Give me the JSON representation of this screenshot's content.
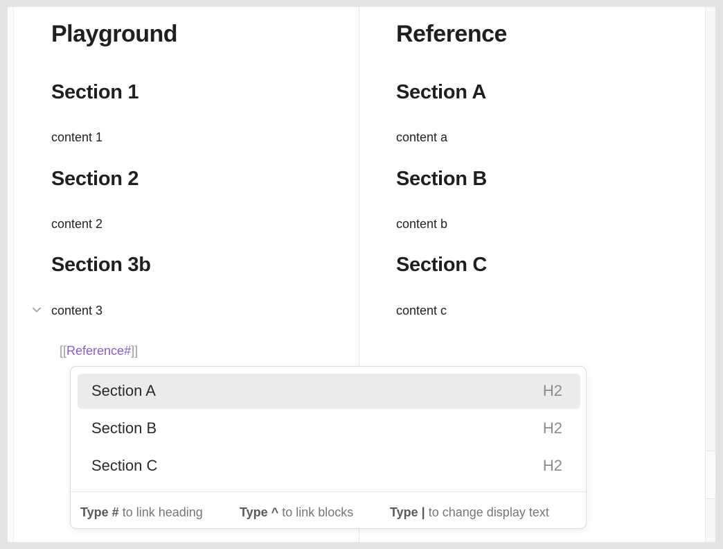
{
  "left_pane": {
    "title": "Playground",
    "sections": [
      {
        "heading": "Section 1",
        "content": "content 1"
      },
      {
        "heading": "Section 2",
        "content": "content 2"
      },
      {
        "heading": "Section 3b",
        "content": "content 3"
      }
    ],
    "link": {
      "open": "[[",
      "text": "Reference#",
      "close": "]]"
    }
  },
  "right_pane": {
    "title": "Reference",
    "sections": [
      {
        "heading": "Section A",
        "content": "content a"
      },
      {
        "heading": "Section B",
        "content": "content b"
      },
      {
        "heading": "Section C",
        "content": "content c"
      }
    ]
  },
  "suggestions": {
    "items": [
      {
        "label": "Section A",
        "level": "H2",
        "selected": true
      },
      {
        "label": "Section B",
        "level": "H2",
        "selected": false
      },
      {
        "label": "Section C",
        "level": "H2",
        "selected": false
      }
    ],
    "hints": [
      {
        "key": "Type #",
        "text": "to link heading"
      },
      {
        "key": "Type ^",
        "text": "to link blocks"
      },
      {
        "key": "Type |",
        "text": "to change display text"
      }
    ]
  },
  "icons": {
    "fold": "chevron-down-icon"
  },
  "colors": {
    "link": "#8a5cd0",
    "selected_bg": "#ebebeb",
    "bracket": "#9a9a9a"
  }
}
